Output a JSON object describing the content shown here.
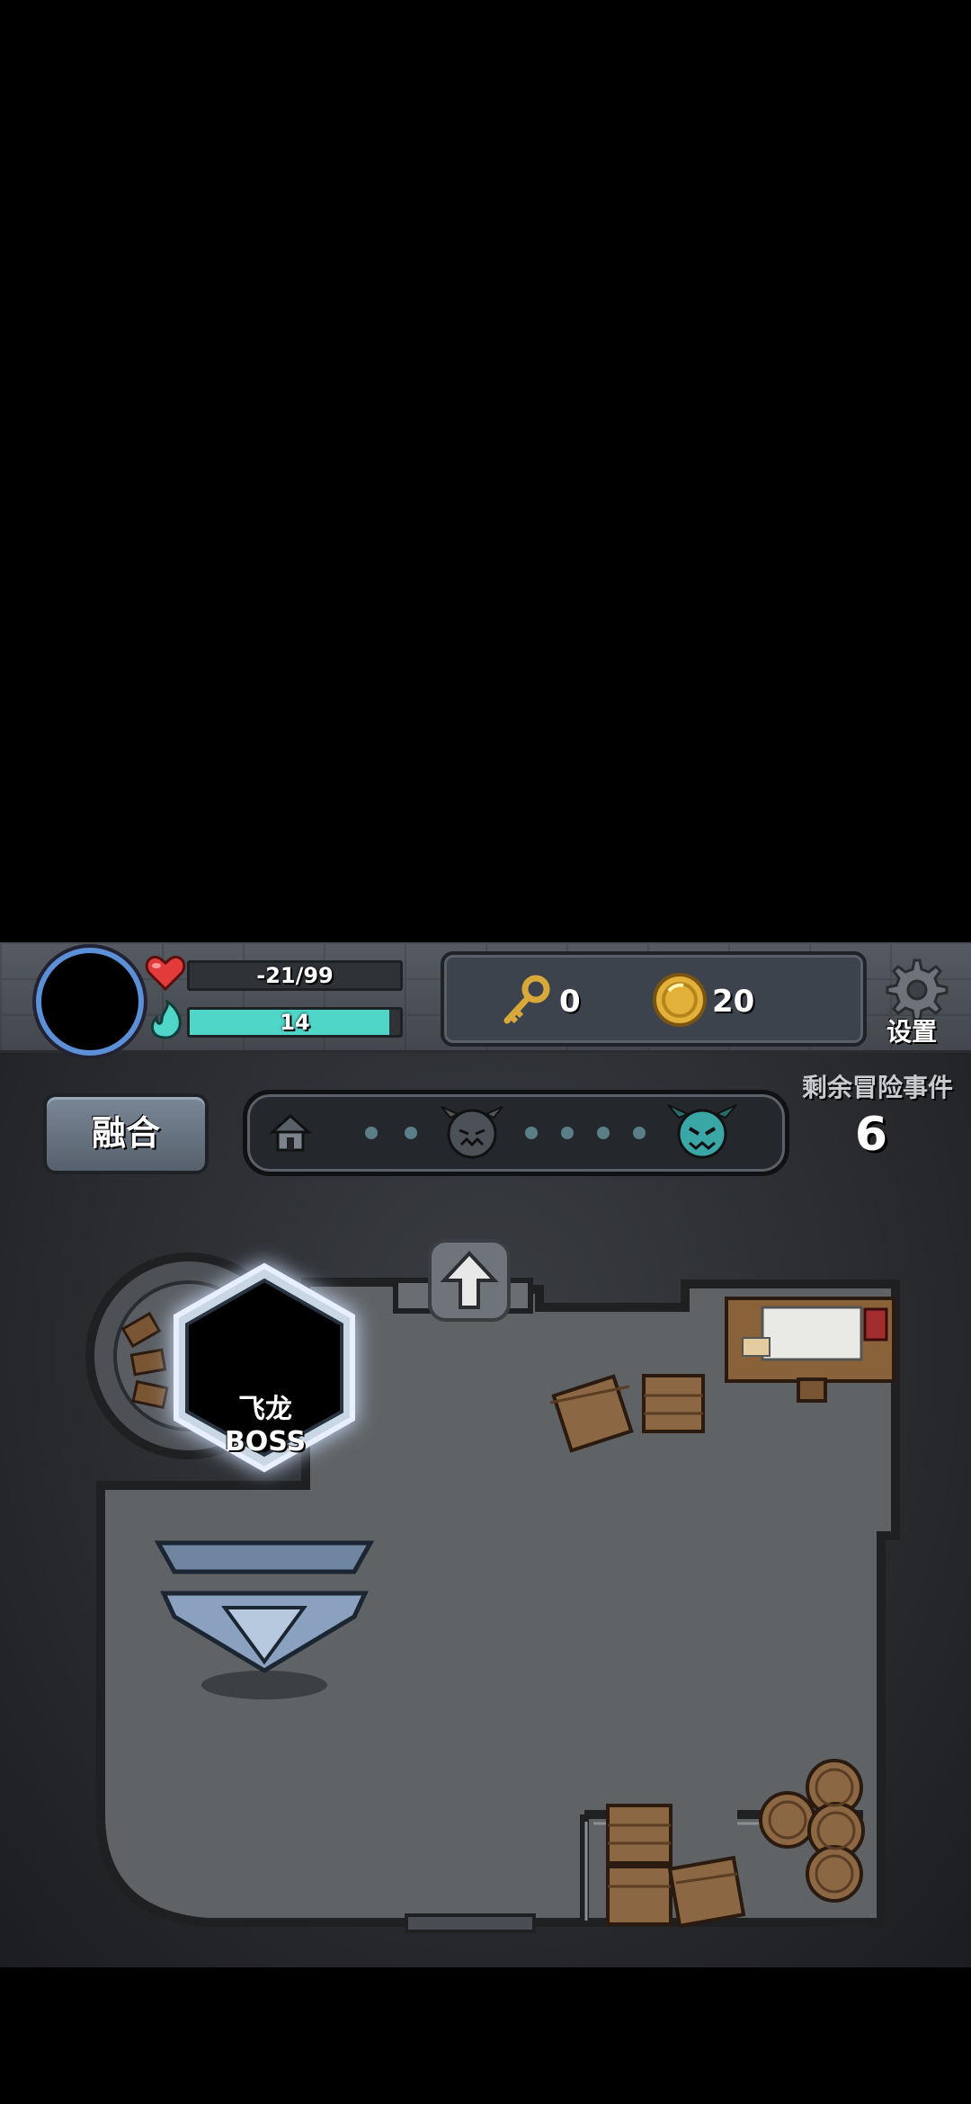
{
  "player": {
    "hp_text": "-21/99",
    "mp_text": "14",
    "mp_fraction": 0.95
  },
  "resources": {
    "keys": "0",
    "coins": "20"
  },
  "settings_label": "设置",
  "fuse_label": "融合",
  "progress_track": {
    "nodes": [
      "house-icon",
      "dot",
      "dot",
      "demon-head-icon",
      "dot",
      "dot",
      "dot",
      "dot",
      "demon-boss-icon"
    ]
  },
  "remaining": {
    "label": "剩余冒险事件",
    "value": "6"
  },
  "boss": {
    "label": "飞龙BOSS"
  },
  "colors": {
    "hp_red": "#e23b3b",
    "mp_teal": "#4fd6c9",
    "avatar_ring": "#5b8fd6",
    "gold": "#e2b13a"
  }
}
